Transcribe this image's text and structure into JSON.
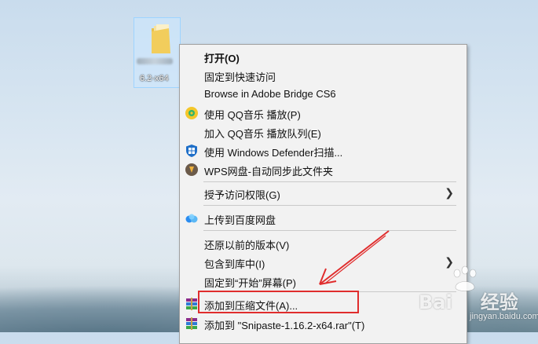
{
  "desktop": {
    "icon_label": "6.2-x64"
  },
  "menu": {
    "items": [
      {
        "label": "打开(O)",
        "bold": true
      },
      {
        "label": "固定到快速访问"
      },
      {
        "label": "Browse in Adobe Bridge CS6"
      },
      {
        "label": "使用 QQ音乐 播放(P)",
        "icon": "qq-music-icon"
      },
      {
        "label": "加入 QQ音乐 播放队列(E)"
      },
      {
        "label": "使用 Windows Defender扫描...",
        "icon": "windows-defender-icon"
      },
      {
        "label": "WPS网盘-自动同步此文件夹",
        "icon": "wps-cloud-icon"
      },
      {
        "label": "授予访问权限(G)",
        "submenu": true
      },
      {
        "label": "上传到百度网盘",
        "icon": "baidu-netdisk-icon"
      },
      {
        "label": "还原以前的版本(V)"
      },
      {
        "label": "包含到库中(I)",
        "submenu": true
      },
      {
        "label": "固定到“开始”屏幕(P)"
      },
      {
        "label": "添加到压缩文件(A)...",
        "icon": "winrar-icon"
      },
      {
        "label": "添加到 \"Snipaste-1.16.2-x64.rar\"(T)",
        "icon": "winrar-icon"
      }
    ]
  },
  "watermark": {
    "text": "Bai",
    "text2": "经验",
    "sub": "jingyan.baidu.com"
  },
  "colors": {
    "highlight_box": "#e02d2d",
    "arrow": "#e02d2d"
  }
}
